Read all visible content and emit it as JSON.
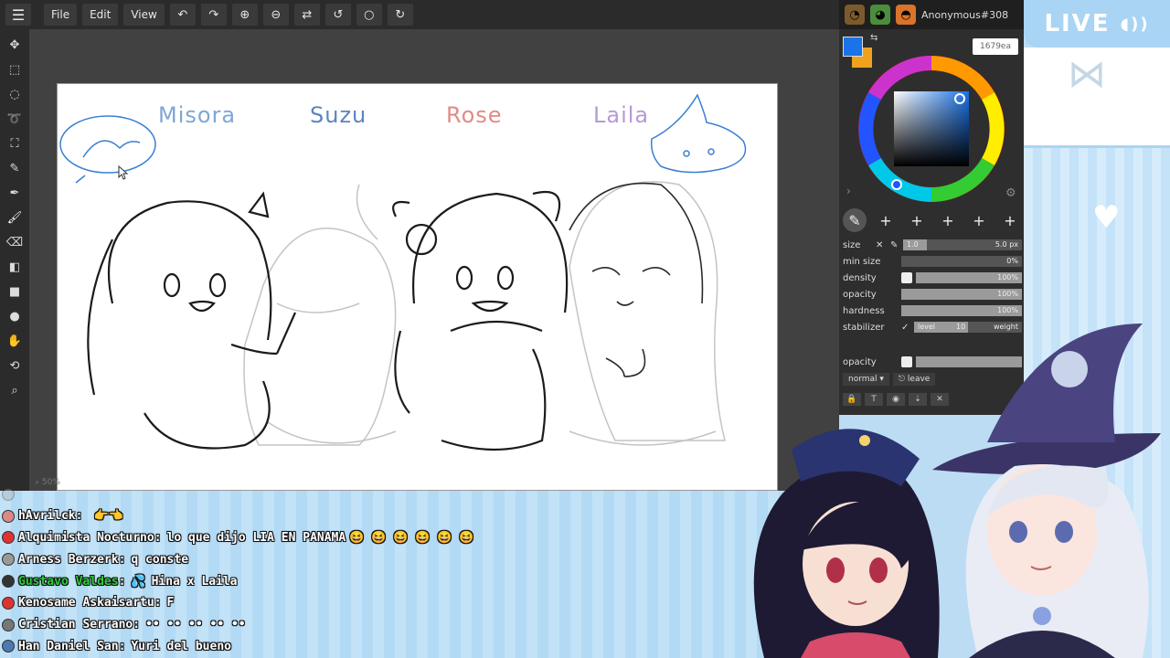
{
  "menubar": {
    "items": [
      {
        "label": "File"
      },
      {
        "label": "Edit"
      },
      {
        "label": "View"
      }
    ]
  },
  "top_right": {
    "user_name": "Anonymous#308",
    "avatars": [
      "mummy-avatar-icon",
      "frog-avatar-icon",
      "cat-avatar-icon"
    ]
  },
  "canvas": {
    "names": [
      {
        "text": "Misora",
        "color": "#7fa6d6"
      },
      {
        "text": "Suzu",
        "color": "#5c84bd"
      },
      {
        "text": "Rose",
        "color": "#e28a86"
      },
      {
        "text": "Laila",
        "color": "#b59ad6"
      }
    ],
    "zoom": "50%"
  },
  "color_panel": {
    "foreground": "#1a73e8",
    "background": "#f0a21e",
    "tooltip": "1679ea"
  },
  "brush": {
    "size_label": "size",
    "size_left": "1.0",
    "size_right": "5.0 px",
    "min_size_label": "min size",
    "min_size_value": "0%",
    "density_label": "density",
    "density_value": "100%",
    "opacity_label": "opacity",
    "opacity_value": "100%",
    "hardness_label": "hardness",
    "hardness_value": "100%",
    "stabilizer_label": "stabilizer",
    "stabilizer_level": "level",
    "stabilizer_level_value": "10",
    "stabilizer_weight": "weight"
  },
  "layers": {
    "opacity_label": "opacity",
    "blend_mode": "normal",
    "leave_label": "leave"
  },
  "stream": {
    "live_label": "LIVE"
  },
  "chat": [
    {
      "user": "hAvrilck",
      "message": "",
      "badge_color": "#d88"
    },
    {
      "user": "Alquimista Nocturno",
      "message": "lo que dijo LIA EN PANAMA",
      "badge_color": "#d33"
    },
    {
      "user": "Arness Berzerk",
      "message": "q conste",
      "badge_color": "#999"
    },
    {
      "user": "Gustavo Valdes",
      "message": "Hina x Laila",
      "badge_color": "#333"
    },
    {
      "user": "Kenosame Askaisartu",
      "message": "F",
      "badge_color": "#d33"
    },
    {
      "user": "Cristian Serrano",
      "message": "",
      "badge_color": "#777"
    },
    {
      "user": "Han Daniel San",
      "message": "Yuri del bueno",
      "badge_color": "#4a7ab0"
    }
  ],
  "colors": {
    "app_bg": "#2b2b2b",
    "canvas_bg": "#ffffff",
    "accent": "#1a73e8",
    "stream_blue": "#a9d4f3"
  }
}
